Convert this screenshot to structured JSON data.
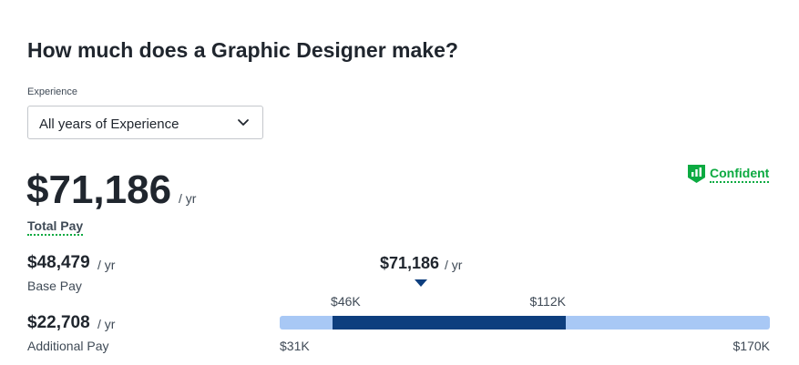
{
  "page": {
    "title": "How much does a Graphic Designer make?"
  },
  "experience": {
    "label": "Experience",
    "selected": "All years of Experience"
  },
  "total": {
    "amount": "$71,186",
    "unit": "/ yr",
    "label": "Total Pay"
  },
  "confidence": {
    "label": "Confident",
    "icon": "bar-chart-shield-icon",
    "color": "#0caa41"
  },
  "base": {
    "amount": "$48,479",
    "unit": "/ yr",
    "label": "Base Pay"
  },
  "additional": {
    "amount": "$22,708",
    "unit": "/ yr",
    "label": "Additional Pay"
  },
  "range": {
    "median_label": "$71,186",
    "median_unit": "/ yr",
    "p25_label": "$46K",
    "p75_label": "$112K",
    "min_label": "$31K",
    "max_label": "$170K",
    "min": 31000,
    "max": 170000,
    "p25": 46000,
    "p75": 112000,
    "median": 71186,
    "colors": {
      "track": "#a8c8f5",
      "fill": "#0d3e7e"
    }
  }
}
